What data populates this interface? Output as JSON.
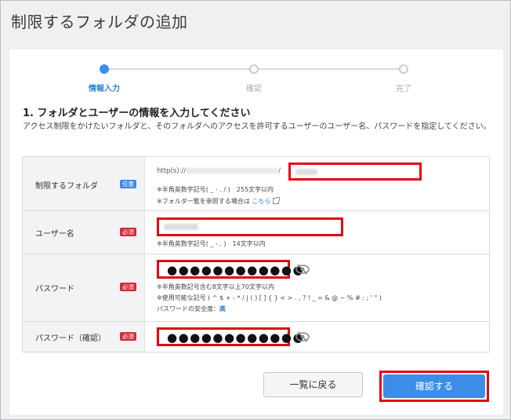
{
  "page": {
    "title": "制限するフォルダの追加"
  },
  "stepper": {
    "steps": [
      {
        "label": "情報入力",
        "active": true
      },
      {
        "label": "確認",
        "active": false
      },
      {
        "label": "完了",
        "active": false
      }
    ]
  },
  "section": {
    "title": "1. フォルダとユーザーの情報を入力してください",
    "description": "アクセス制限をかけたいフォルダと、そのフォルダへのアクセスを許可するユーザーのユーザー名、パスワードを指定してください。"
  },
  "form": {
    "folder": {
      "label": "制限するフォルダ",
      "badge": "任意",
      "url_prefix": "http(s)://",
      "url_sep": "/",
      "note1": "※半角英数字記号( _ - . / )　255文字以内",
      "note2_prefix": "※フォルダ一覧を参照する場合は",
      "note2_link": "こちら"
    },
    "username": {
      "label": "ユーザー名",
      "badge": "必須",
      "note": "※半角英数字記号( _ - . )　14文字以内"
    },
    "password": {
      "label": "パスワード",
      "badge": "必須",
      "value": "●●●●●●●●●●●●",
      "note1": "※半角英数記号含む8文字以上70文字以内",
      "note2": "※使用可能な記号 ( ^ $ + - * / | ( ) [ ] { } < > . , ? ! _ = & @ ~ % # : ; ' \" )",
      "strength_label": "パスワードの安全度：",
      "strength_value": "高"
    },
    "password_confirm": {
      "label": "パスワード（確認）",
      "badge": "必須",
      "value": "●●●●●●●●●●●●"
    }
  },
  "buttons": {
    "back": "一覧に戻る",
    "confirm": "確認する"
  },
  "colors": {
    "accent": "#3a8ee8",
    "required": "#d3293a",
    "optional": "#3b8ae6",
    "highlight": "#e30613"
  }
}
